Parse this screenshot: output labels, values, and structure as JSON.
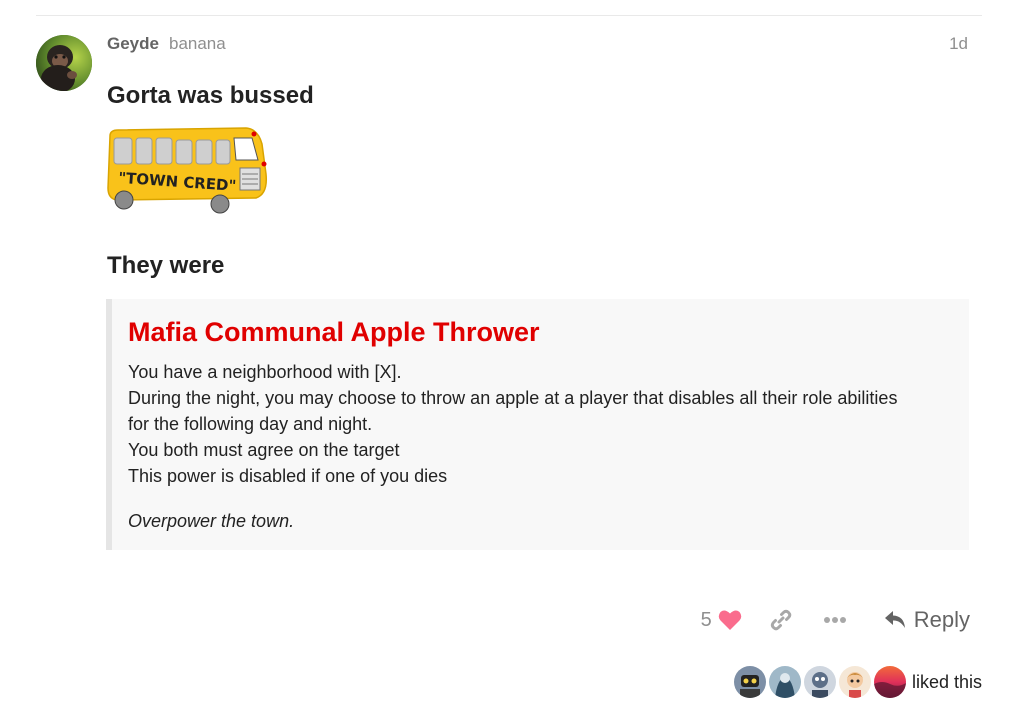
{
  "post": {
    "username": "Geyde",
    "user_title": "banana",
    "date": "1d",
    "heading": "Gorta was bussed",
    "bus_label": "\"TOWN CRED\"",
    "subheading": "They were"
  },
  "role": {
    "name": "Mafia Communal Apple Thrower",
    "lines": [
      "You have a neighborhood with [X].",
      "During the night, you may choose to throw an apple at a player that disables all their role abilities",
      "for the following day and night.",
      "You both must agree on the target",
      "This power is disabled if one of you dies"
    ],
    "flavor": "Overpower the town."
  },
  "actions": {
    "like_count": "5",
    "reply_label": "Reply",
    "liked_text": "liked this"
  },
  "colors": {
    "role_title": "#e00000",
    "heart": "#fa6c8d",
    "muted": "#8f8f8f"
  },
  "icons": [
    "heart-icon",
    "link-icon",
    "ellipsis-icon",
    "reply-arrow-icon"
  ]
}
